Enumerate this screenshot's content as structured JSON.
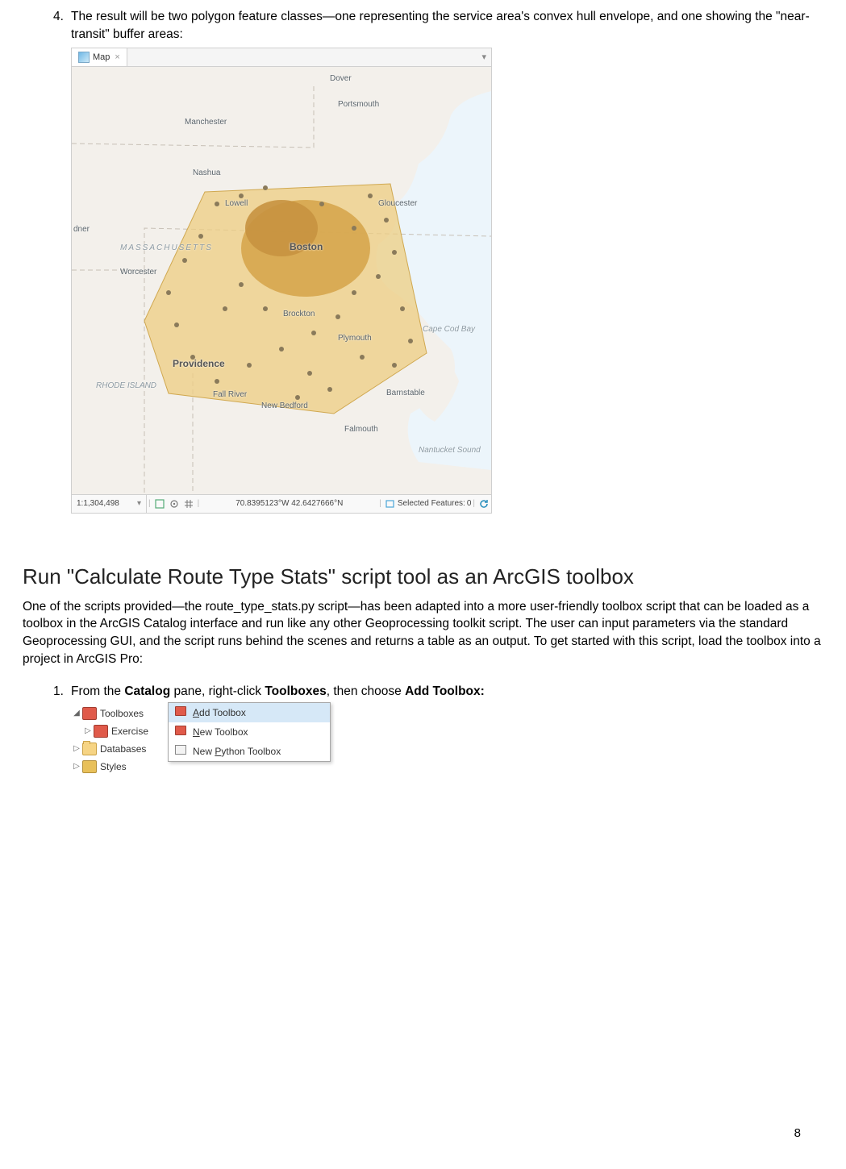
{
  "step4": {
    "number": "4.",
    "text": "The result will be two polygon feature classes—one representing the service area's convex hull envelope, and one showing the \"near-transit\" buffer areas:"
  },
  "map": {
    "tab_label": "Map",
    "scale": "1:1,304,498",
    "coords": "70.8395123°W 42.6427666°N",
    "selected_label": "Selected Features:",
    "selected_count": "0",
    "labels": {
      "dover": "Dover",
      "portsmouth": "Portsmouth",
      "manchester": "Manchester",
      "nashua": "Nashua",
      "lowell": "Lowell",
      "gloucester": "Gloucester",
      "mass": "MASSACHUSETTS",
      "boston": "Boston",
      "worcester": "Worcester",
      "brockton": "Brockton",
      "plymouth": "Plymouth",
      "capecod": "Cape Cod Bay",
      "providence": "Providence",
      "ri": "RHODE ISLAND",
      "fallriver": "Fall River",
      "newbedford": "New Bedford",
      "barnstable": "Barnstable",
      "falmouth": "Falmouth",
      "nantucket": "Nantucket Sound",
      "dner": "dner"
    }
  },
  "heading": "Run \"Calculate Route Type Stats\" script tool as an ArcGIS toolbox",
  "intro_para": "One of the scripts provided—the route_type_stats.py script—has been adapted into a more user-friendly toolbox script that can be loaded as a toolbox in the ArcGIS Catalog interface and run like any other Geoprocessing toolkit script.  The user can input parameters via the standard Geoprocessing GUI, and the script runs behind the scenes and returns a table as an output.  To get started with this script, load the toolbox into a project in ArcGIS Pro:",
  "step1": {
    "number": "1.",
    "pre": "From the ",
    "catalog": "Catalog",
    "mid": " pane, right-click ",
    "toolboxes": "Toolboxes",
    "post": ", then choose ",
    "add": "Add Toolbox:"
  },
  "catalog": {
    "toolboxes": "Toolboxes",
    "exercise": "Exercise",
    "databases": "Databases",
    "styles": "Styles",
    "menu": {
      "add": "dd Toolbox",
      "new": "ew Toolbox",
      "py": "ython Toolbox",
      "newprefix": "New "
    }
  },
  "page_number": "8"
}
